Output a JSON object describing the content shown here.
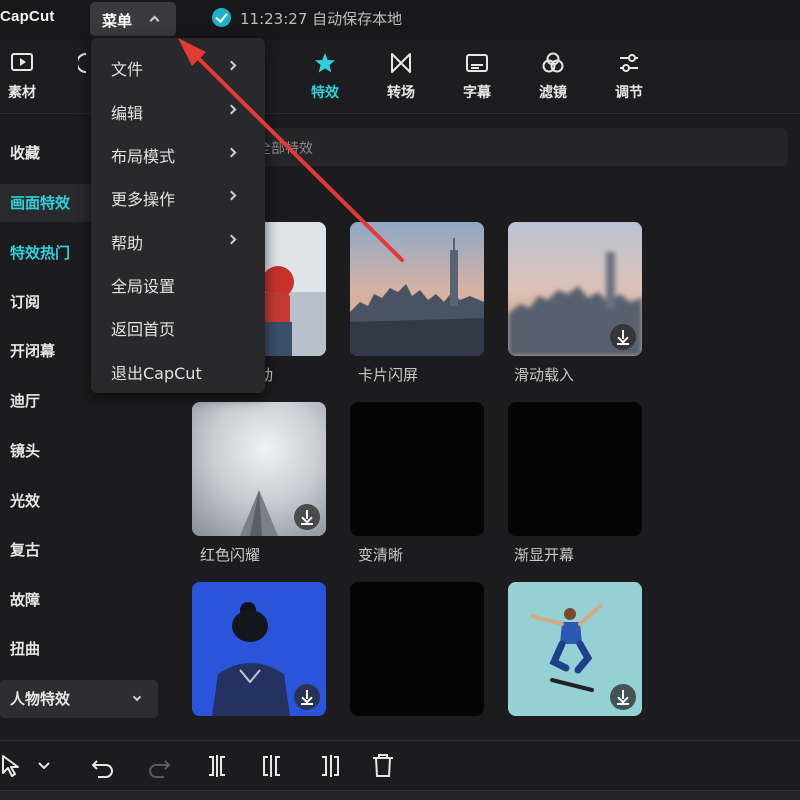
{
  "topbar": {
    "logo": "CapCut",
    "menu_label": "菜单",
    "save_time": "11:23:27",
    "save_text": "自动保存本地"
  },
  "toolbar": {
    "items": [
      {
        "label": "素材",
        "icon": "media-icon"
      },
      {
        "label": "",
        "icon": "audio-icon"
      },
      {
        "label": "特效",
        "icon": "effects-star-icon",
        "active": true
      },
      {
        "label": "转场",
        "icon": "transition-icon"
      },
      {
        "label": "字幕",
        "icon": "subtitle-icon"
      },
      {
        "label": "滤镜",
        "icon": "filter-icon"
      },
      {
        "label": "调节",
        "icon": "adjust-icon"
      }
    ]
  },
  "sidebar": {
    "items": [
      {
        "label": "收藏"
      },
      {
        "label": "画面特效",
        "state": "active"
      },
      {
        "label": "特效热门",
        "state": "highlight"
      },
      {
        "label": "订阅"
      },
      {
        "label": "开闭幕"
      },
      {
        "label": "迪厅"
      },
      {
        "label": "镜头"
      },
      {
        "label": "光效"
      },
      {
        "label": "复古"
      },
      {
        "label": "故障"
      },
      {
        "label": "扭曲"
      },
      {
        "label": "人物特效",
        "dropdown": true
      }
    ]
  },
  "search": {
    "placeholder": "全部特效"
  },
  "effects": [
    {
      "label": "动"
    },
    {
      "label": "卡片闪屏"
    },
    {
      "label": "滑动载入"
    },
    {
      "label": "红色闪耀"
    },
    {
      "label": "变清晰"
    },
    {
      "label": "渐显开幕"
    },
    {
      "label": "",
      "partial": true
    },
    {
      "label": "",
      "partial": true
    },
    {
      "label": "",
      "partial": true
    }
  ],
  "menu": {
    "items": [
      {
        "label": "文件",
        "submenu": true
      },
      {
        "label": "编辑",
        "submenu": true
      },
      {
        "label": "布局模式",
        "submenu": true
      },
      {
        "label": "更多操作",
        "submenu": true
      },
      {
        "label": "帮助",
        "submenu": true
      },
      {
        "label": "全局设置",
        "submenu": false
      },
      {
        "label": "返回首页",
        "submenu": false
      },
      {
        "label": "退出CapCut",
        "submenu": false
      }
    ]
  },
  "colors": {
    "accent": "#2bd2dc",
    "annotation_arrow": "#e53935",
    "background": "#1c1c1e",
    "menu_bg": "#29292c"
  }
}
